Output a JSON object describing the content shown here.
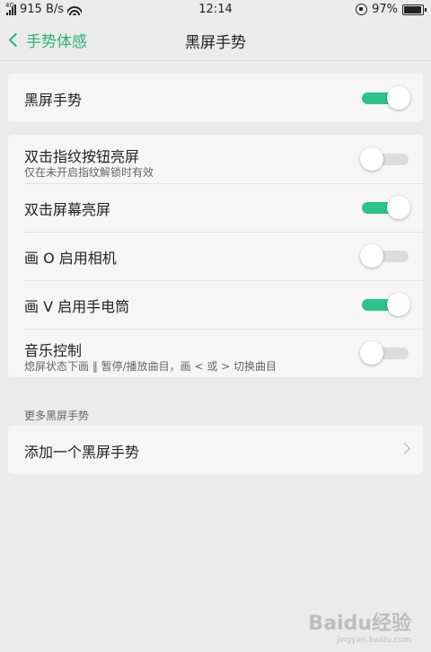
{
  "status_bar": {
    "network_type": "4G",
    "speed": "915 B/s",
    "time": "12:14",
    "battery": "97%",
    "battery_level": 0.97
  },
  "nav": {
    "back_label": "手势体感",
    "title": "黑屏手势"
  },
  "main_toggle": {
    "label": "黑屏手势",
    "on": true
  },
  "gestures": [
    {
      "label": "双击指纹按钮亮屏",
      "subtitle": "仅在未开启指纹解锁时有效",
      "on": false
    },
    {
      "label": "双击屏幕亮屏",
      "subtitle": "",
      "on": true
    },
    {
      "label": "画 O 启用相机",
      "subtitle": "",
      "on": false
    },
    {
      "label": "画 V 启用手电筒",
      "subtitle": "",
      "on": true
    },
    {
      "label": "音乐控制",
      "subtitle": "熄屏状态下画 ‖ 暂停/播放曲目，画 < 或 > 切换曲目",
      "on": false
    }
  ],
  "more_section": {
    "header": "更多黑屏手势",
    "add_label": "添加一个黑屏手势"
  },
  "colors": {
    "accent": "#2bb07b",
    "toggle_on": "#2bc38a",
    "toggle_off": "#dcdcdc",
    "background": "#ebebeb",
    "card": "#f6f6f6"
  },
  "watermark": {
    "brand": "Baidu经验",
    "url": "jingyan.baidu.com"
  }
}
